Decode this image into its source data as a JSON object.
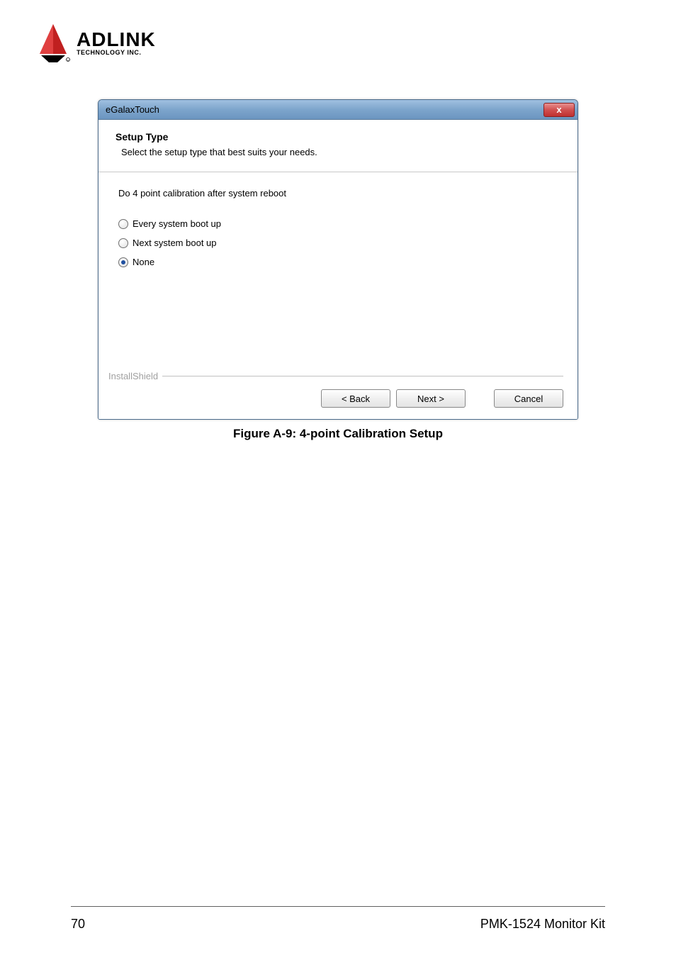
{
  "logo": {
    "main_text": "ADLINK",
    "sub_text": "TECHNOLOGY INC."
  },
  "dialog": {
    "window_title": "eGalaxTouch",
    "close_symbol": "x",
    "setup_title": "Setup Type",
    "setup_desc": "Select the setup type that best suits your needs.",
    "instruction": "Do 4 point calibration after system reboot",
    "radios": [
      {
        "label": "Every system boot up",
        "selected": false
      },
      {
        "label": "Next system boot up",
        "selected": false
      },
      {
        "label": "None",
        "selected": true
      }
    ],
    "installshield_label": "InstallShield",
    "buttons": {
      "back": "< Back",
      "next": "Next >",
      "cancel": "Cancel"
    }
  },
  "figure_caption": "Figure A-9: 4-point Calibration Setup",
  "footer": {
    "page_number": "70",
    "doc_title": "PMK-1524 Monitor Kit"
  }
}
